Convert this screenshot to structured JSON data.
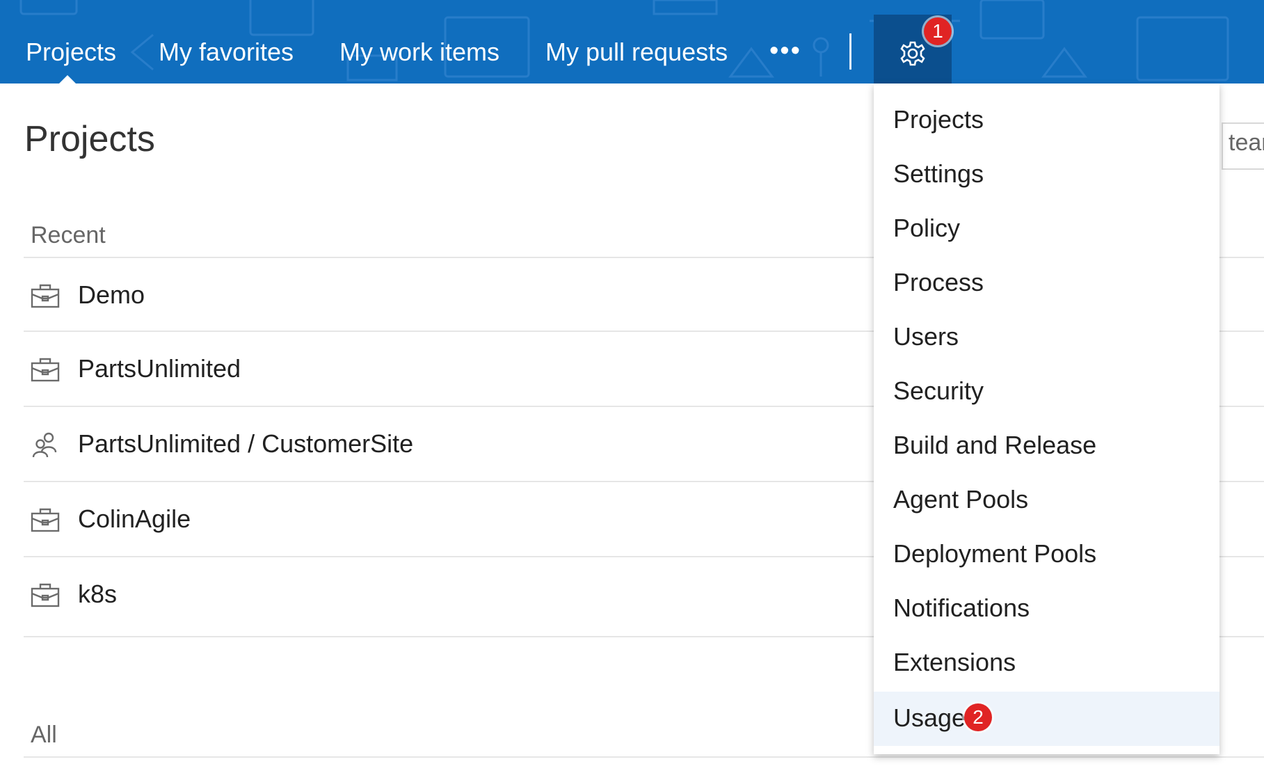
{
  "topnav": {
    "items": [
      "Projects",
      "My favorites",
      "My work items",
      "My pull requests"
    ],
    "active_index": 0,
    "more_label": "•••",
    "settings_icon": "gear-icon",
    "settings_badge": "1"
  },
  "page": {
    "title": "Projects",
    "search_fragment": "tear"
  },
  "recent": {
    "label": "Recent",
    "items": [
      {
        "name": "Demo",
        "icon": "project-icon"
      },
      {
        "name": "PartsUnlimited",
        "icon": "project-icon"
      },
      {
        "name": "PartsUnlimited / CustomerSite",
        "icon": "team-icon"
      },
      {
        "name": "ColinAgile",
        "icon": "project-icon"
      },
      {
        "name": "k8s",
        "icon": "project-icon"
      }
    ]
  },
  "all": {
    "label": "All"
  },
  "settings_menu": {
    "items": [
      "Projects",
      "Settings",
      "Policy",
      "Process",
      "Users",
      "Security",
      "Build and Release",
      "Agent Pools",
      "Deployment Pools",
      "Notifications",
      "Extensions",
      "Usage"
    ],
    "highlighted_index": 11,
    "highlight_badge": "2"
  },
  "colors": {
    "topbar": "#106ebe",
    "gear_button_bg": "#0b4f8e",
    "badge": "#e02424",
    "menu_highlight": "#eef4fb"
  }
}
